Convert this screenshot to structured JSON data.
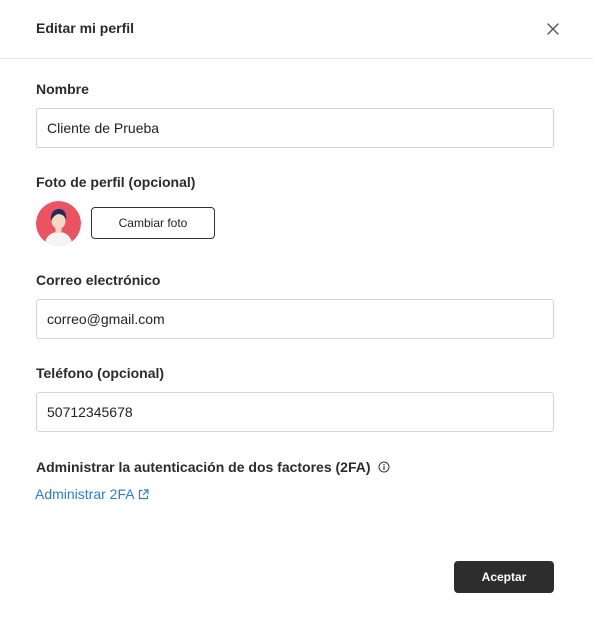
{
  "dialog": {
    "title": "Editar mi perfil"
  },
  "form": {
    "name_label": "Nombre",
    "name_value": "Cliente de Prueba",
    "photo_label": "Foto de perfil (opcional)",
    "change_photo_label": "Cambiar foto",
    "email_label": "Correo electrónico",
    "email_value": "correo@gmail.com",
    "phone_label": "Teléfono (opcional)",
    "phone_value": "50712345678",
    "twofa_label": "Administrar la autenticación de dos factores (2FA)",
    "twofa_link": "Administrar 2FA"
  },
  "footer": {
    "accept_label": "Aceptar"
  },
  "icons": {
    "close": "close-icon",
    "info": "info-icon",
    "external": "external-link-icon",
    "avatar": "avatar"
  },
  "colors": {
    "link": "#2a7fc7",
    "primary_button": "#2d2d2d",
    "avatar_bg": "#ea5462"
  }
}
